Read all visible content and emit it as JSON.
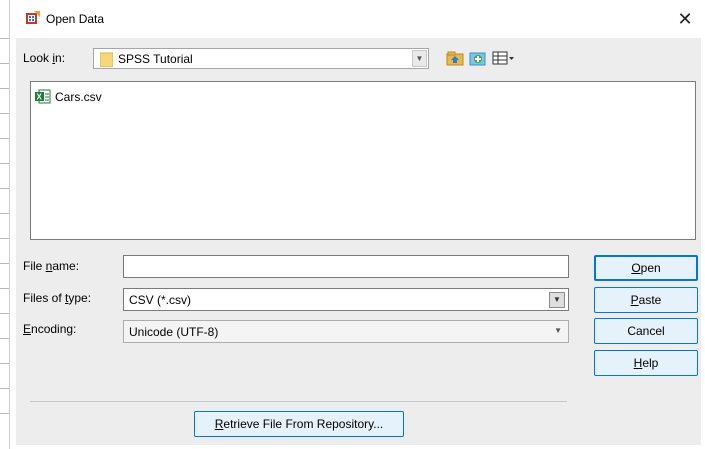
{
  "window": {
    "title": "Open Data",
    "close_glyph": "✕"
  },
  "lookin": {
    "label_pre": "Look ",
    "label_acc": "i",
    "label_post": "n:",
    "value": "SPSS Tutorial"
  },
  "toolbar": {
    "icons": [
      "up-folder-icon",
      "new-folder-icon",
      "view-menu-icon"
    ]
  },
  "files": [
    {
      "name": "Cars.csv",
      "icon": "csv-file-icon"
    }
  ],
  "filename": {
    "label_pre": "File ",
    "label_acc": "n",
    "label_post": "ame:",
    "value": ""
  },
  "filetype": {
    "label_pre": "Files of ",
    "label_acc": "t",
    "label_post": "ype:",
    "value": "CSV (*.csv)"
  },
  "encoding": {
    "label_acc": "E",
    "label_post": "ncoding:",
    "value": "Unicode (UTF-8)"
  },
  "buttons": {
    "open_acc": "O",
    "open_post": "pen",
    "paste_acc": "P",
    "paste_post": "aste",
    "cancel": "Cancel",
    "help_acc": "H",
    "help_post": "elp"
  },
  "retrieve": {
    "acc": "R",
    "post": "etrieve File From Repository..."
  },
  "colors": {
    "accent": "#0078d7",
    "dialog_bg": "#ededed",
    "folder": "#f5d87a"
  }
}
